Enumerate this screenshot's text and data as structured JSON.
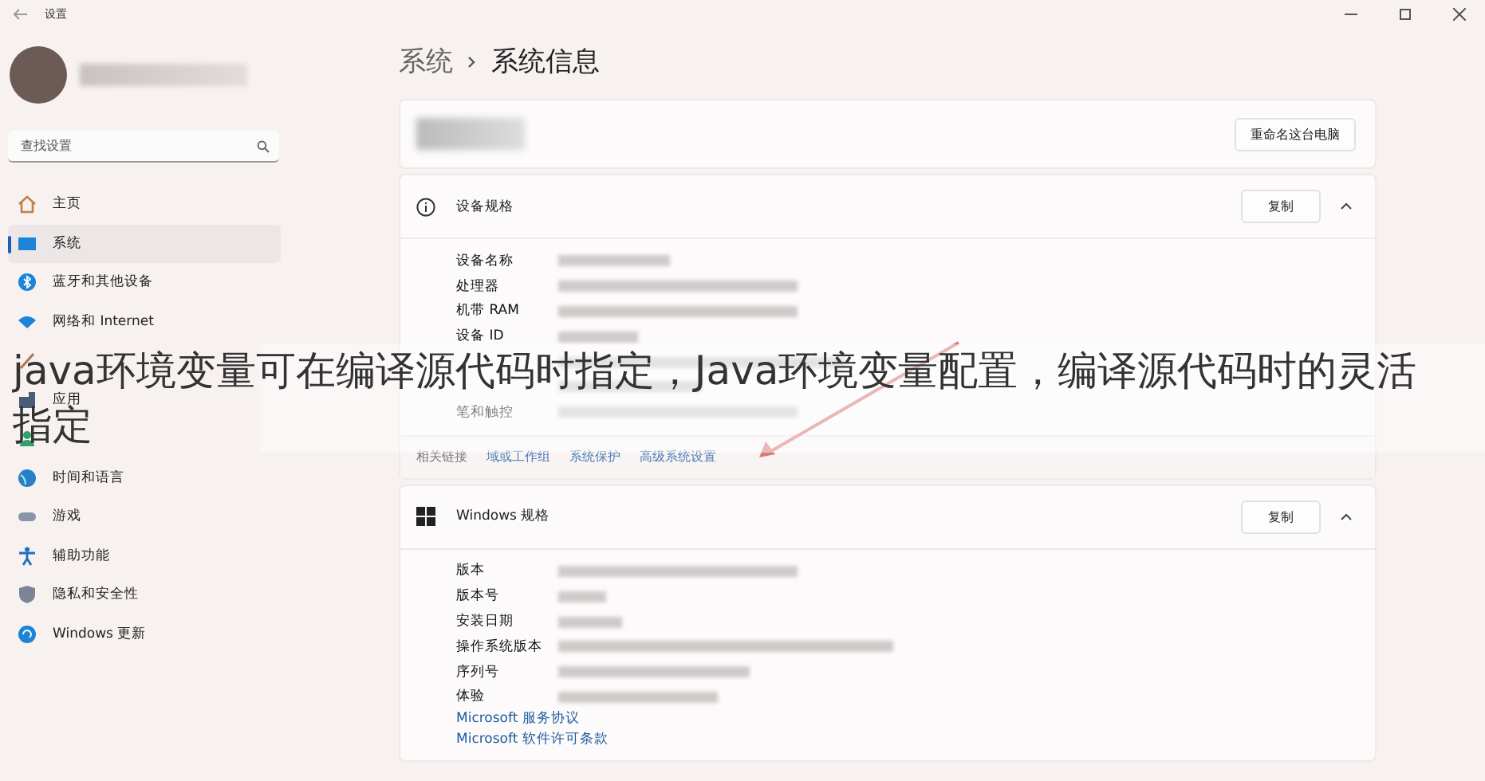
{
  "window": {
    "title": "设置"
  },
  "search": {
    "placeholder": "查找设置"
  },
  "sidebar": {
    "items": [
      {
        "label": "主页",
        "selected": false
      },
      {
        "label": "系统",
        "selected": true
      },
      {
        "label": "蓝牙和其他设备",
        "selected": false
      },
      {
        "label": "网络和 Internet",
        "selected": false
      },
      {
        "selected": false
      },
      {
        "label": "应用",
        "selected": false
      },
      {
        "selected": false
      },
      {
        "label": "时间和语言",
        "selected": false
      },
      {
        "label": "游戏",
        "selected": false
      },
      {
        "label": "辅助功能",
        "selected": false
      },
      {
        "label": "隐私和安全性",
        "selected": false
      },
      {
        "label": "Windows 更新",
        "selected": false
      }
    ]
  },
  "breadcrumb": {
    "parent": "系统",
    "current": "系统信息"
  },
  "device_card": {
    "button": "重命名这台电脑"
  },
  "sections": [
    {
      "kind": "device",
      "title": "设备规格",
      "button": "复制",
      "expanded": true,
      "rows": [
        {
          "kind": "spec",
          "label": "设备名称"
        },
        {
          "kind": "spec",
          "label": "处理器"
        },
        {
          "kind": "spec",
          "label": "机带 RAM"
        },
        {
          "kind": "spec",
          "label": "设备 ID"
        },
        {
          "kind": "obscured"
        },
        {
          "kind": "obscured"
        },
        {
          "kind": "spec",
          "label": "笔和触控"
        }
      ],
      "related": {
        "label": "相关链接",
        "links": [
          "域或工作组",
          "系统保护",
          "高级系统设置"
        ]
      }
    },
    {
      "kind": "windows",
      "title": "Windows 规格",
      "button": "复制",
      "expanded": true,
      "rows": [
        {
          "kind": "spec",
          "label": "版本"
        },
        {
          "kind": "spec",
          "label": "版本号"
        },
        {
          "kind": "spec",
          "label": "安装日期"
        },
        {
          "kind": "spec",
          "label": "操作系统版本"
        },
        {
          "kind": "spec",
          "label": "序列号"
        },
        {
          "kind": "spec",
          "label": "体验"
        }
      ],
      "links": [
        "Microsoft 服务协议",
        "Microsoft 软件许可条款"
      ]
    }
  ],
  "overlay": {
    "caption": "java环境变量可在编译源代码时指定，Java环境变量配置，编译源代码时的灵活指定"
  }
}
